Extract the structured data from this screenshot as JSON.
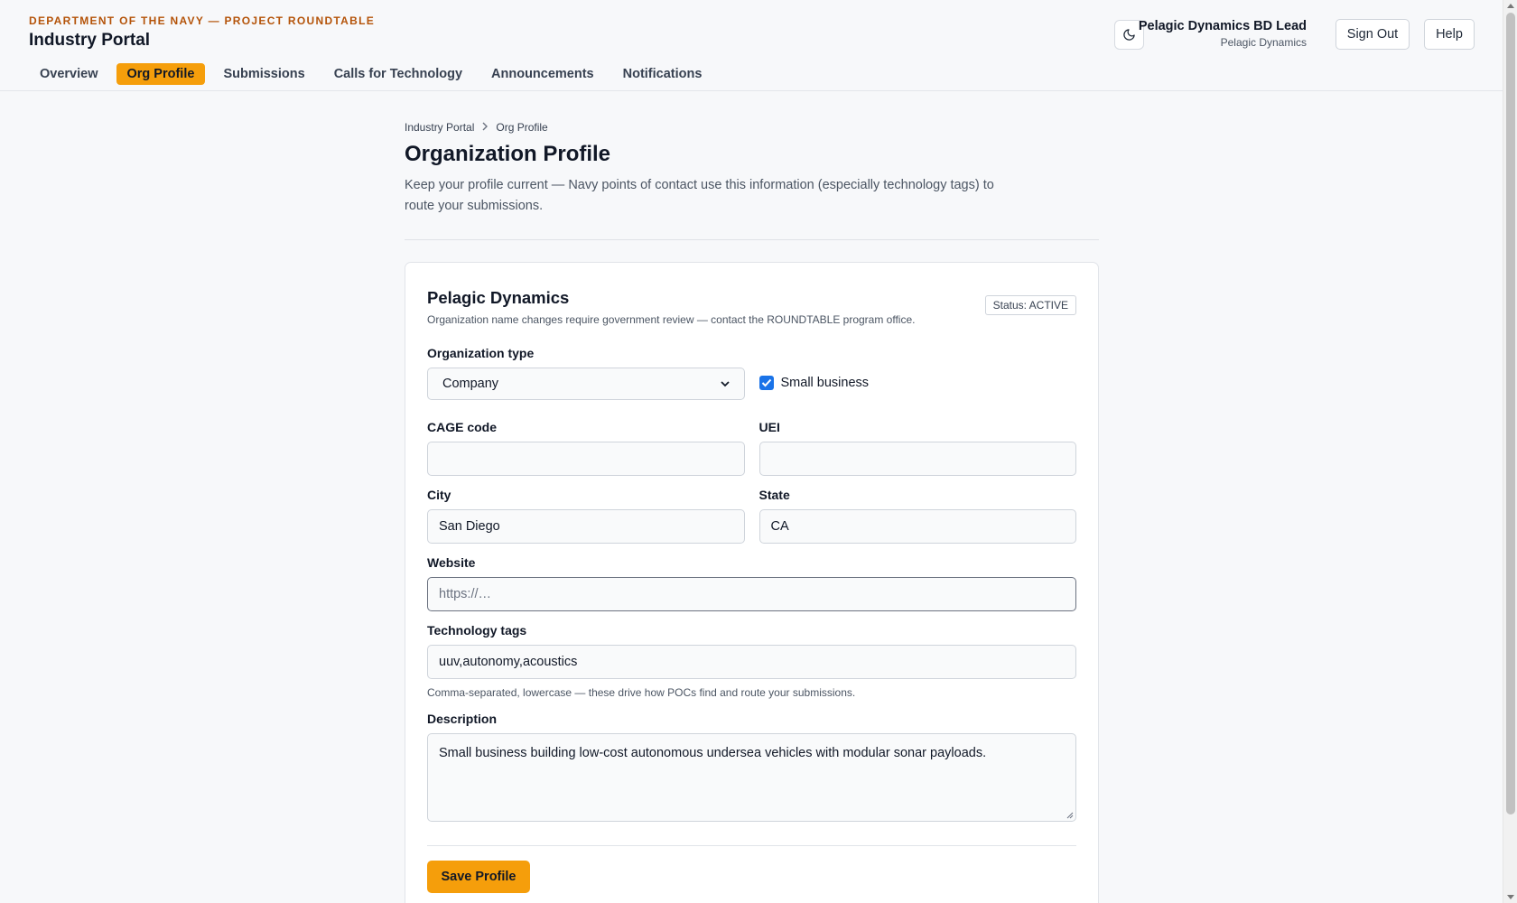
{
  "header": {
    "eyebrow": "DEPARTMENT OF THE NAVY — PROJECT ROUNDTABLE",
    "title": "Industry Portal",
    "tabs": [
      "Overview",
      "Org Profile",
      "Submissions",
      "Calls for Technology",
      "Announcements",
      "Notifications"
    ],
    "active_tab": "Org Profile",
    "user_name": "Pelagic Dynamics BD Lead",
    "user_org": "Pelagic Dynamics",
    "sign_out_label": "Sign Out",
    "help_label": "Help",
    "theme_icon": "moon-icon"
  },
  "breadcrumb": [
    "Industry Portal",
    "Org Profile"
  ],
  "page": {
    "title": "Organization Profile",
    "description": "Keep your profile current — Navy points of contact use this information (especially technology tags) to route your submissions."
  },
  "profile": {
    "org_name": "Pelagic Dynamics",
    "org_note": "Organization name changes require government review — contact the ROUNDTABLE program office.",
    "status": "Status: ACTIVE",
    "org_type_label": "Organization type",
    "org_type_value": "Company",
    "small_business_label": "Small business",
    "small_business_checked": true,
    "cage_label": "CAGE code",
    "cage_value": "",
    "uei_label": "UEI",
    "uei_value": "",
    "city_label": "City",
    "city_value": "San Diego",
    "state_label": "State",
    "state_value": "CA",
    "website_label": "Website",
    "website_placeholder": "https://…",
    "tags_label": "Technology tags",
    "tags_value": "uuv,autonomy,acoustics",
    "tags_hint": "Comma-separated, lowercase — these drive how POCs find and route your submissions.",
    "description_label": "Description",
    "description_value": "Small business building low-cost autonomous undersea vehicles with modular sonar payloads.",
    "save_label": "Save Profile"
  },
  "colors": {
    "accent": "#f59e0b",
    "eyebrow": "#b45309",
    "checkbox": "#1a73e8"
  }
}
